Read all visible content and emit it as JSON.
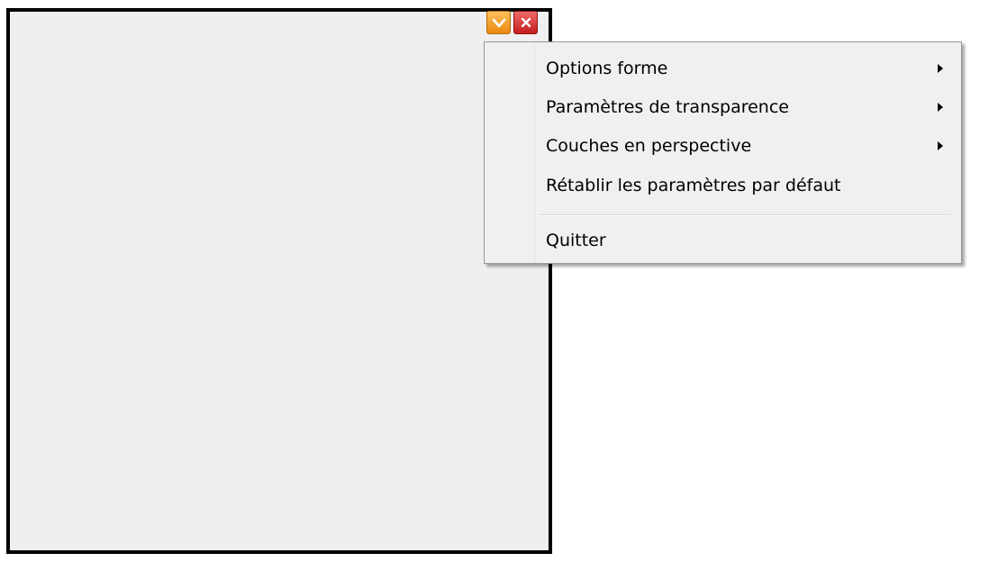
{
  "title_buttons": {
    "menu_icon": "menu-dropdown-icon",
    "close_icon": "close-icon",
    "menu_color": "#f0a030",
    "close_color": "#d62a2a"
  },
  "context_menu": {
    "items": [
      {
        "label": "Options forme",
        "has_submenu": true
      },
      {
        "label": "Paramètres de transparence",
        "has_submenu": true
      },
      {
        "label": "Couches en perspective",
        "has_submenu": true
      },
      {
        "label": "Rétablir les paramètres par défaut",
        "has_submenu": false
      },
      {
        "label": "Quitter",
        "has_submenu": false
      }
    ]
  },
  "colors": {
    "window_bg": "#efefef",
    "window_border": "#000000",
    "menu_bg": "#f0f0f0"
  }
}
